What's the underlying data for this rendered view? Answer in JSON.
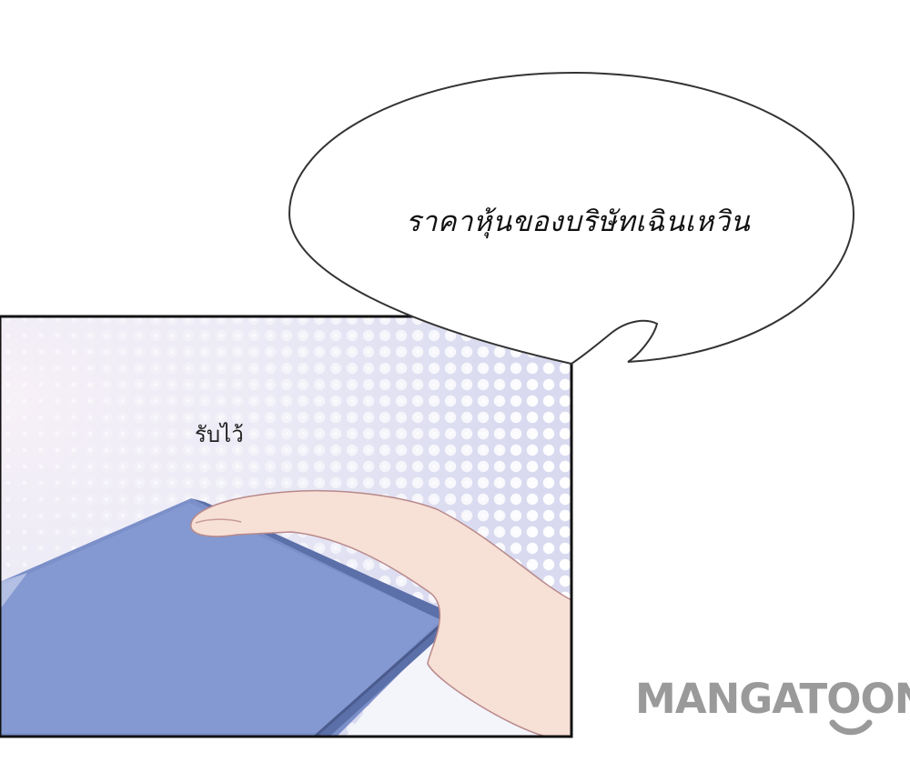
{
  "speech_bubble": {
    "text": "ราคาหุ้นของบริษัทเฉินเหวิน"
  },
  "panel": {
    "caption": "รับไว้"
  },
  "watermark": {
    "text": "MANGATOON",
    "color": "#9a9a9a"
  },
  "icons": [
    "speech-bubble-icon",
    "hand-holding-folder-illustration",
    "smile-logo-icon"
  ]
}
